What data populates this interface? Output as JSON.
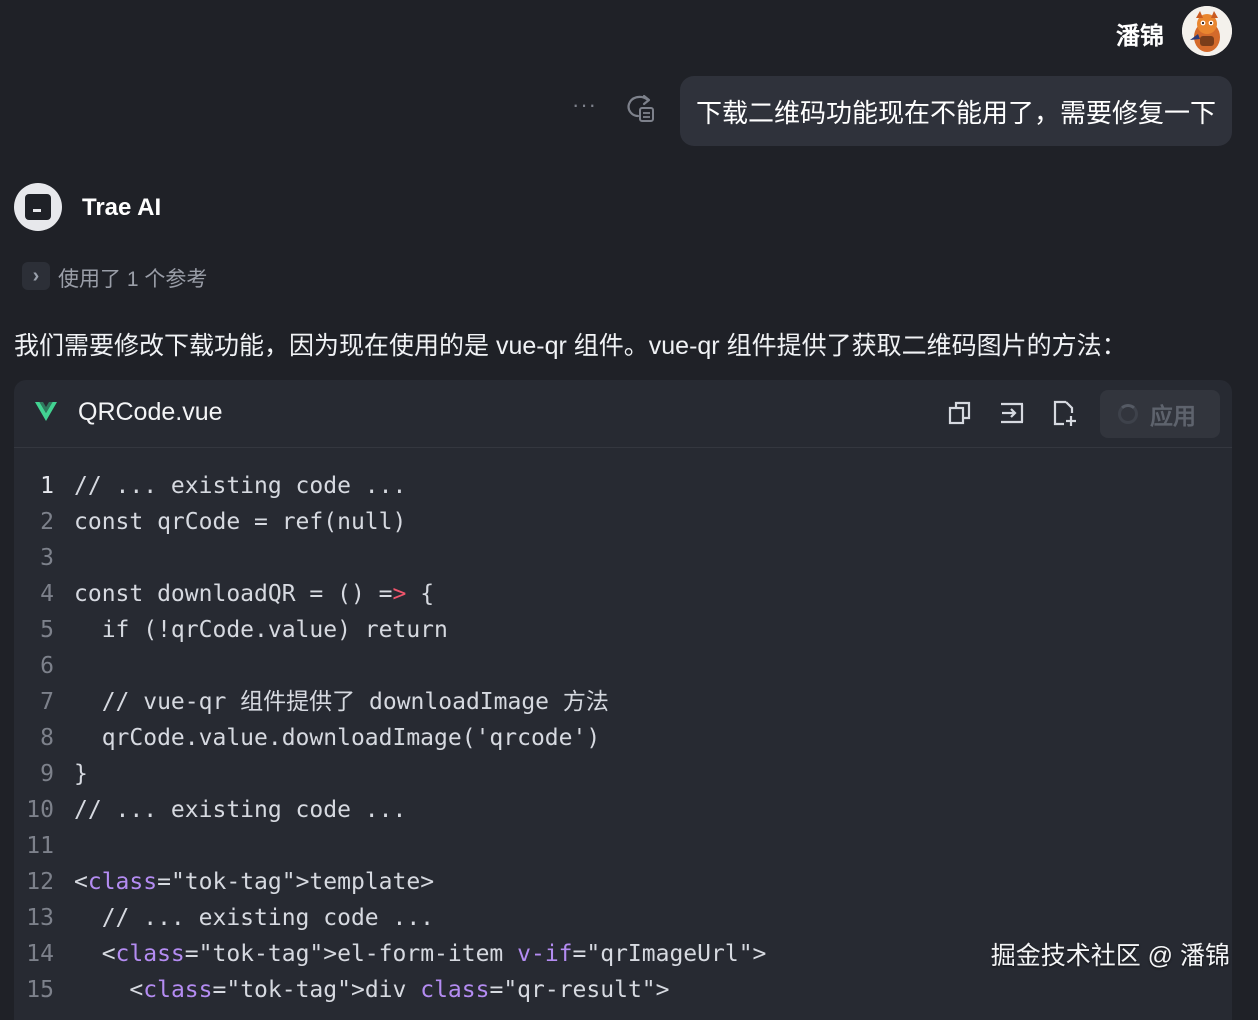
{
  "user": {
    "name": "潘锦",
    "message": "下载二维码功能现在不能用了，需要修复一下",
    "more_glyph": "···"
  },
  "ai": {
    "name": "Trae AI",
    "reference_label": "使用了 1 个参考",
    "intro": "我们需要修改下载功能，因为现在使用的是 vue-qr 组件。vue-qr 组件提供了获取二维码图片的方法："
  },
  "code_block": {
    "file_name": "QRCode.vue",
    "apply_label": "应用",
    "lines": [
      {
        "num": "1",
        "text": "// ... existing code ..."
      },
      {
        "num": "2",
        "text": "const qrCode = ref(null)"
      },
      {
        "num": "3",
        "text": ""
      },
      {
        "num": "4",
        "text": "const downloadQR = () => {"
      },
      {
        "num": "5",
        "text": "  if (!qrCode.value) return"
      },
      {
        "num": "6",
        "text": ""
      },
      {
        "num": "7",
        "text": "  // vue-qr 组件提供了 downloadImage 方法"
      },
      {
        "num": "8",
        "text": "  qrCode.value.downloadImage('qrcode')"
      },
      {
        "num": "9",
        "text": "}"
      },
      {
        "num": "10",
        "text": "// ... existing code ..."
      },
      {
        "num": "11",
        "text": ""
      },
      {
        "num": "12",
        "text": "<template>"
      },
      {
        "num": "13",
        "text": "  // ... existing code ..."
      },
      {
        "num": "14",
        "text": "  <el-form-item v-if=\"qrImageUrl\">"
      },
      {
        "num": "15",
        "text": "    <div class=\"qr-result\">"
      }
    ]
  },
  "watermark": "掘金技术社区 @ 潘锦",
  "colors": {
    "background": "#1f2127",
    "bubble": "#2f323b",
    "code_bg": "#272a32",
    "vue_green": "#42d392",
    "tag_red": "#f47c7c",
    "attr_purple": "#b48cf2"
  }
}
